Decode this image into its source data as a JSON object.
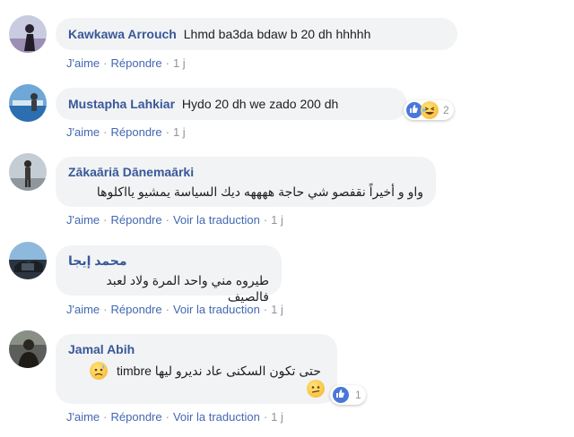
{
  "actions": {
    "like": "J'aime",
    "reply": "Répondre",
    "translate": "Voir la traduction",
    "sep": "·"
  },
  "comments": [
    {
      "author": "Kawkawa Arrouch",
      "text": "Lhmd ba3da bdaw b 20 dh hhhhh",
      "time": "1 j"
    },
    {
      "author": "Mustapha Lahkiar",
      "text": "Hydo 20 dh we zado 200 dh",
      "time": "1 j",
      "reaction_count": "2",
      "reactions": [
        "like-icon",
        "laughing-emoji-icon"
      ]
    },
    {
      "author": "Zākaāriā Dānemaārki",
      "text": "واو و أخيراً نقفصو شي حاجة ههههه ديك السياسة يمشيو يااكلوها",
      "time": "1 j"
    },
    {
      "author": "محمد إيجا",
      "text": "طيروه مني واحد المرة ولاد لعبد فالصيف",
      "time": "1 j"
    },
    {
      "author": "Jamal Abih",
      "text": "حتى تكون السكنى عاد نديرو ليها timbre",
      "time": "1 j",
      "reaction_count": "1",
      "reactions": [
        "like-icon"
      ]
    }
  ],
  "colors": {
    "author": "#385898",
    "link": "#4267b2",
    "muted": "#90949c",
    "bubble": "#f2f3f5"
  }
}
